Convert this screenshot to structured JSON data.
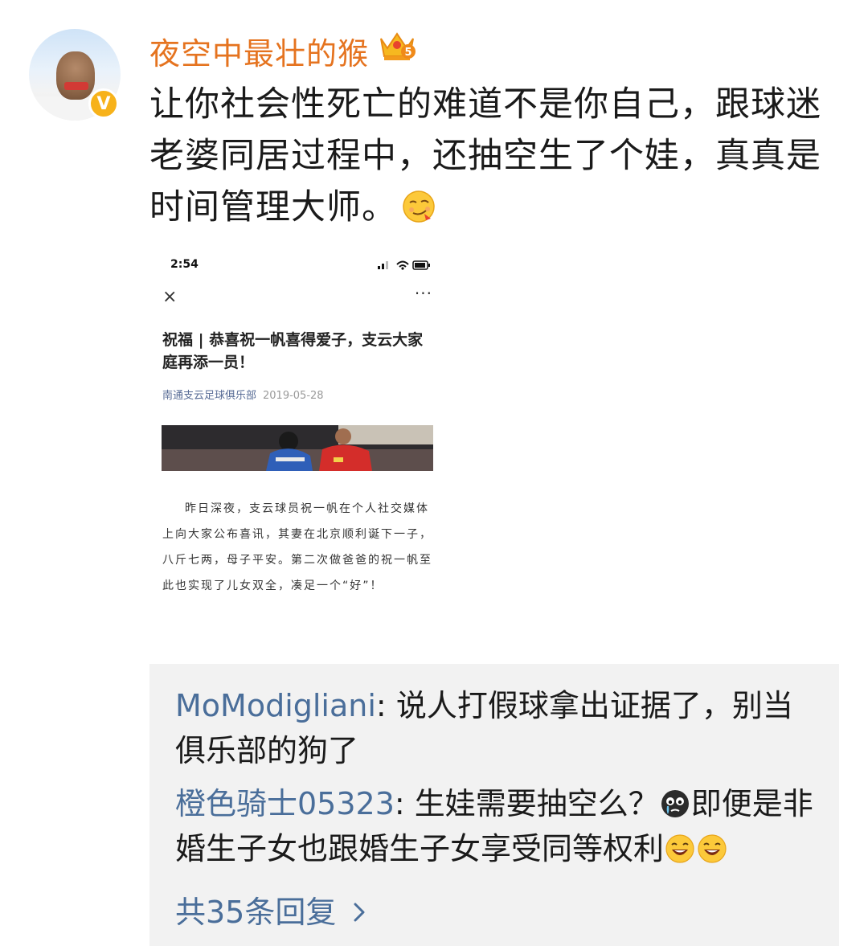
{
  "post": {
    "username": "夜空中最壮的猴",
    "crown_level": "5",
    "verified_mark": "V",
    "text": "让你社会性死亡的难道不是你自己，跟球迷老婆同居过程中，还抽空生了个娃，真真是时间管理大师。",
    "text_emoji": "smirk-emoji"
  },
  "screenshot": {
    "status_time": "2:54",
    "close_glyph": "×",
    "more_glyph": "···",
    "title": "祝福 | 恭喜祝一帆喜得爱子，支云大家庭再添一员！",
    "source": "南通支云足球俱乐部",
    "date": "2019-05-28",
    "body": "昨日深夜，支云球员祝一帆在个人社交媒体上向大家公布喜讯，其妻在北京顺利诞下一子，八斤七两，母子平安。第二次做爸爸的祝一帆至此也实现了儿女双全，凑足一个“好”！"
  },
  "comments": [
    {
      "author": "MoModigliani",
      "sep": ": ",
      "text": "说人打假球拿出证据了，别当俱乐部的狗了"
    },
    {
      "author": "橙色骑士05323",
      "sep": ": ",
      "text_before": "生娃需要抽空么？",
      "text_after": "即便是非婚生子女也跟婚生子女享受同等权利"
    }
  ],
  "replies_label": "共35条回复",
  "colors": {
    "username": "#e5731f",
    "comment_author": "#4a6e9a",
    "comments_bg": "#f2f2f2",
    "verified": "#f7b21a"
  }
}
